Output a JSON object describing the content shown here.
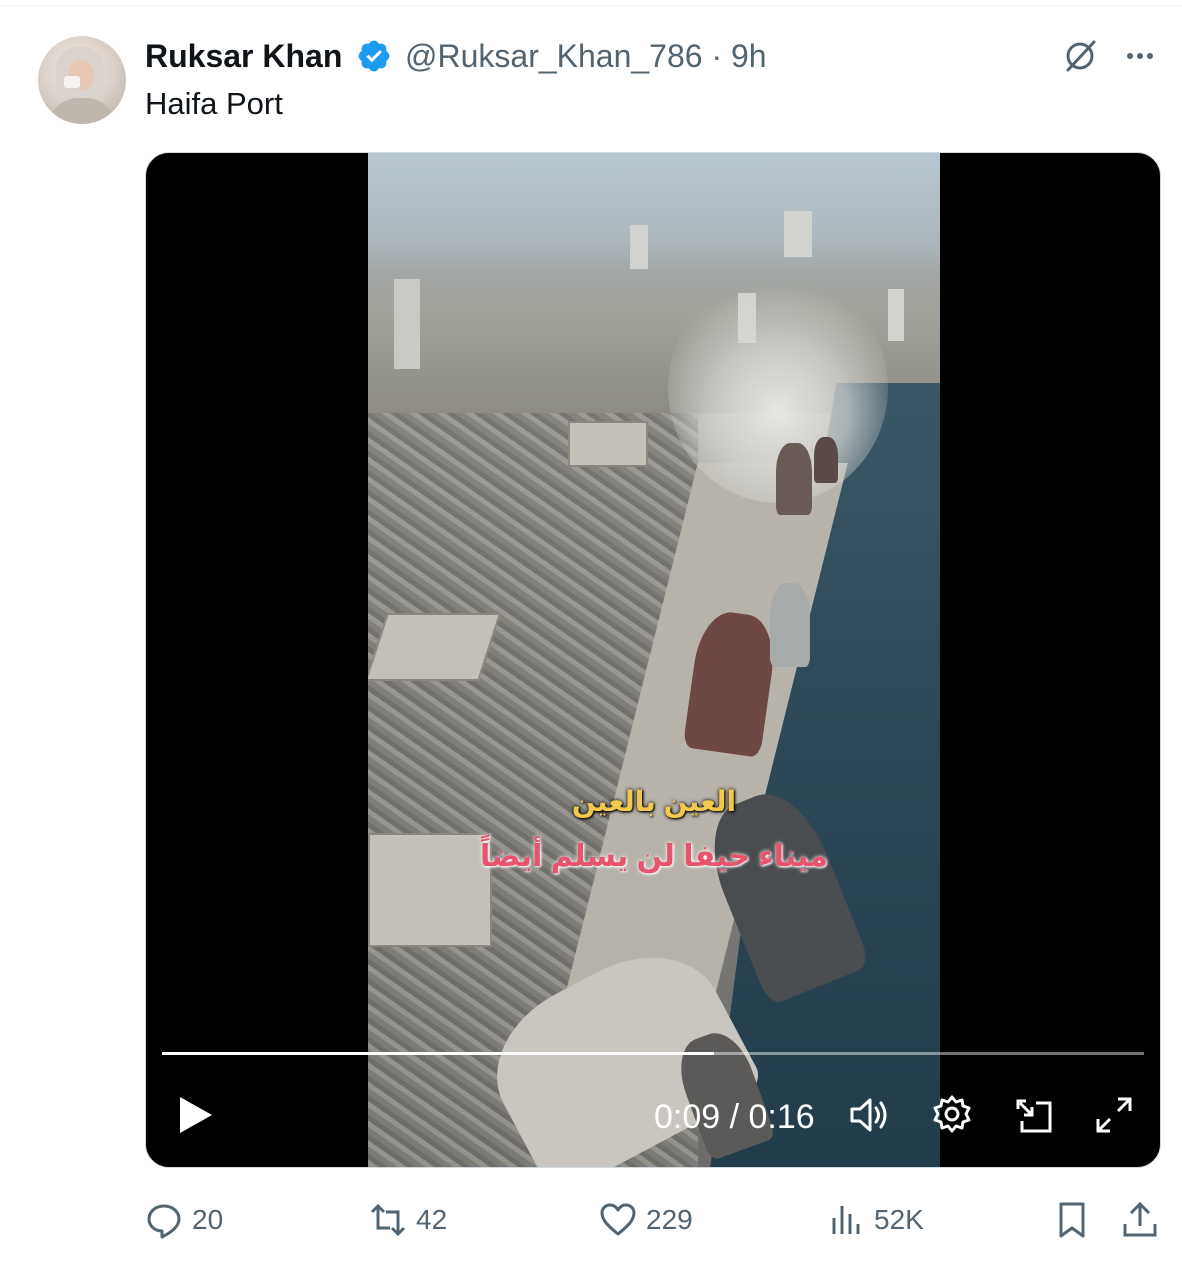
{
  "author": {
    "name": "Ruksar Khan",
    "handle": "@Ruksar_Khan_786",
    "time": "9h",
    "handle_time": "@Ruksar_Khan_786 · 9h",
    "verified_color": "#1d9bf0"
  },
  "tweet": {
    "text": "Haifa Port"
  },
  "video": {
    "subtitle_top": "العين بالعين",
    "subtitle_bottom": "ميناء حيفا لن يسلم أيضاً",
    "current_time": "0:09",
    "duration": "0:16",
    "time_display": "0:09 / 0:16",
    "progress": 0.5625
  },
  "actions": {
    "replies": "20",
    "reposts": "42",
    "likes": "229",
    "views": "52K"
  },
  "icons": [
    "grok-icon",
    "more-icon",
    "play-icon",
    "volume-icon",
    "settings-icon",
    "pip-icon",
    "fullscreen-icon",
    "reply-icon",
    "repost-icon",
    "like-icon",
    "views-icon",
    "bookmark-icon",
    "share-icon"
  ]
}
